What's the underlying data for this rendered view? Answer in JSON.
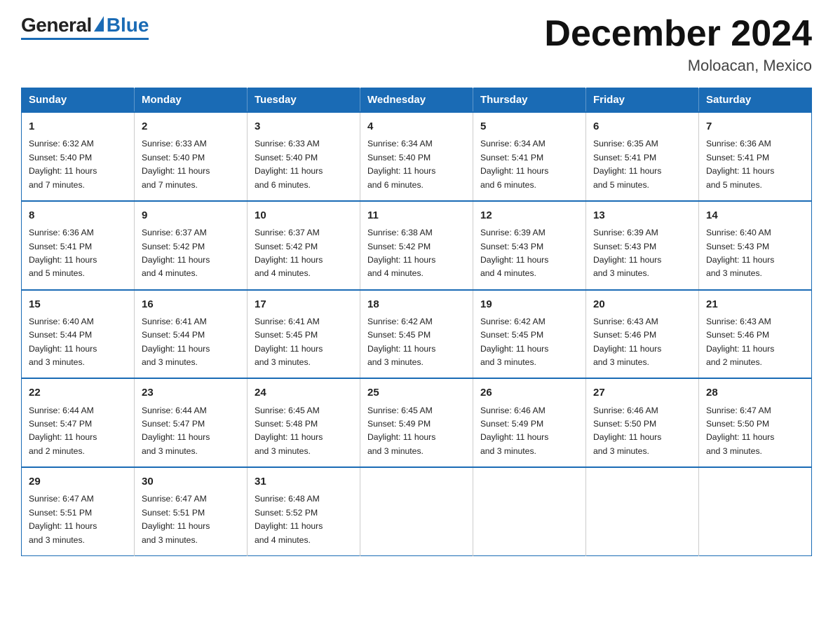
{
  "header": {
    "logo_general": "General",
    "logo_blue": "Blue",
    "month_title": "December 2024",
    "location": "Moloacan, Mexico"
  },
  "weekdays": [
    "Sunday",
    "Monday",
    "Tuesday",
    "Wednesday",
    "Thursday",
    "Friday",
    "Saturday"
  ],
  "weeks": [
    [
      {
        "day": "1",
        "sunrise": "6:32 AM",
        "sunset": "5:40 PM",
        "daylight": "11 hours and 7 minutes."
      },
      {
        "day": "2",
        "sunrise": "6:33 AM",
        "sunset": "5:40 PM",
        "daylight": "11 hours and 7 minutes."
      },
      {
        "day": "3",
        "sunrise": "6:33 AM",
        "sunset": "5:40 PM",
        "daylight": "11 hours and 6 minutes."
      },
      {
        "day": "4",
        "sunrise": "6:34 AM",
        "sunset": "5:40 PM",
        "daylight": "11 hours and 6 minutes."
      },
      {
        "day": "5",
        "sunrise": "6:34 AM",
        "sunset": "5:41 PM",
        "daylight": "11 hours and 6 minutes."
      },
      {
        "day": "6",
        "sunrise": "6:35 AM",
        "sunset": "5:41 PM",
        "daylight": "11 hours and 5 minutes."
      },
      {
        "day": "7",
        "sunrise": "6:36 AM",
        "sunset": "5:41 PM",
        "daylight": "11 hours and 5 minutes."
      }
    ],
    [
      {
        "day": "8",
        "sunrise": "6:36 AM",
        "sunset": "5:41 PM",
        "daylight": "11 hours and 5 minutes."
      },
      {
        "day": "9",
        "sunrise": "6:37 AM",
        "sunset": "5:42 PM",
        "daylight": "11 hours and 4 minutes."
      },
      {
        "day": "10",
        "sunrise": "6:37 AM",
        "sunset": "5:42 PM",
        "daylight": "11 hours and 4 minutes."
      },
      {
        "day": "11",
        "sunrise": "6:38 AM",
        "sunset": "5:42 PM",
        "daylight": "11 hours and 4 minutes."
      },
      {
        "day": "12",
        "sunrise": "6:39 AM",
        "sunset": "5:43 PM",
        "daylight": "11 hours and 4 minutes."
      },
      {
        "day": "13",
        "sunrise": "6:39 AM",
        "sunset": "5:43 PM",
        "daylight": "11 hours and 3 minutes."
      },
      {
        "day": "14",
        "sunrise": "6:40 AM",
        "sunset": "5:43 PM",
        "daylight": "11 hours and 3 minutes."
      }
    ],
    [
      {
        "day": "15",
        "sunrise": "6:40 AM",
        "sunset": "5:44 PM",
        "daylight": "11 hours and 3 minutes."
      },
      {
        "day": "16",
        "sunrise": "6:41 AM",
        "sunset": "5:44 PM",
        "daylight": "11 hours and 3 minutes."
      },
      {
        "day": "17",
        "sunrise": "6:41 AM",
        "sunset": "5:45 PM",
        "daylight": "11 hours and 3 minutes."
      },
      {
        "day": "18",
        "sunrise": "6:42 AM",
        "sunset": "5:45 PM",
        "daylight": "11 hours and 3 minutes."
      },
      {
        "day": "19",
        "sunrise": "6:42 AM",
        "sunset": "5:45 PM",
        "daylight": "11 hours and 3 minutes."
      },
      {
        "day": "20",
        "sunrise": "6:43 AM",
        "sunset": "5:46 PM",
        "daylight": "11 hours and 3 minutes."
      },
      {
        "day": "21",
        "sunrise": "6:43 AM",
        "sunset": "5:46 PM",
        "daylight": "11 hours and 2 minutes."
      }
    ],
    [
      {
        "day": "22",
        "sunrise": "6:44 AM",
        "sunset": "5:47 PM",
        "daylight": "11 hours and 2 minutes."
      },
      {
        "day": "23",
        "sunrise": "6:44 AM",
        "sunset": "5:47 PM",
        "daylight": "11 hours and 3 minutes."
      },
      {
        "day": "24",
        "sunrise": "6:45 AM",
        "sunset": "5:48 PM",
        "daylight": "11 hours and 3 minutes."
      },
      {
        "day": "25",
        "sunrise": "6:45 AM",
        "sunset": "5:49 PM",
        "daylight": "11 hours and 3 minutes."
      },
      {
        "day": "26",
        "sunrise": "6:46 AM",
        "sunset": "5:49 PM",
        "daylight": "11 hours and 3 minutes."
      },
      {
        "day": "27",
        "sunrise": "6:46 AM",
        "sunset": "5:50 PM",
        "daylight": "11 hours and 3 minutes."
      },
      {
        "day": "28",
        "sunrise": "6:47 AM",
        "sunset": "5:50 PM",
        "daylight": "11 hours and 3 minutes."
      }
    ],
    [
      {
        "day": "29",
        "sunrise": "6:47 AM",
        "sunset": "5:51 PM",
        "daylight": "11 hours and 3 minutes."
      },
      {
        "day": "30",
        "sunrise": "6:47 AM",
        "sunset": "5:51 PM",
        "daylight": "11 hours and 3 minutes."
      },
      {
        "day": "31",
        "sunrise": "6:48 AM",
        "sunset": "5:52 PM",
        "daylight": "11 hours and 4 minutes."
      },
      null,
      null,
      null,
      null
    ]
  ],
  "labels": {
    "sunrise": "Sunrise:",
    "sunset": "Sunset:",
    "daylight": "Daylight:"
  }
}
